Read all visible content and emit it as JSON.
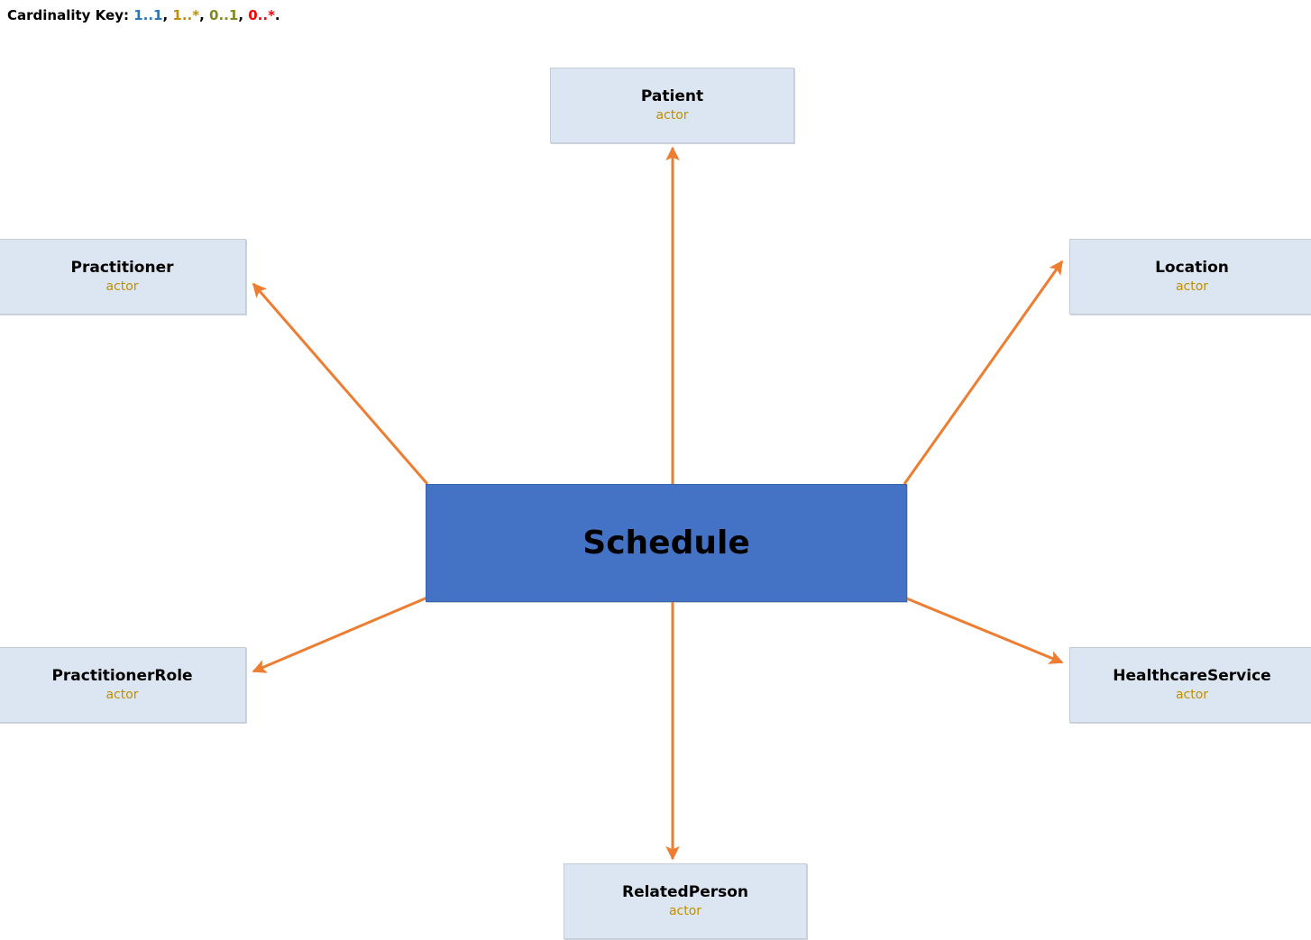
{
  "diagram": {
    "title": "Schedule",
    "background_color": "#ffffff",
    "connector_color": "#ed7d31",
    "central_fill": "#4472c4",
    "actor_fill": "#dce6f2",
    "actor_border": "#c3ccd9",
    "subtitle_color": "#bf8f00"
  },
  "cardinality_key": {
    "label": "Cardinality Key:",
    "entries": [
      {
        "text": "1..1",
        "color": "#2e75b6"
      },
      {
        "text": "1..*",
        "color": "#bf8f00"
      },
      {
        "text": "0..1",
        "color": "#7f8b1f"
      },
      {
        "text": "0..*",
        "color": "#ff0000"
      }
    ],
    "separator": ", ",
    "terminator": "."
  },
  "central": {
    "name": "Schedule"
  },
  "nodes": [
    {
      "id": "patient",
      "name": "Patient",
      "subtitle": "actor"
    },
    {
      "id": "practitioner",
      "name": "Practitioner",
      "subtitle": "actor"
    },
    {
      "id": "location",
      "name": "Location",
      "subtitle": "actor"
    },
    {
      "id": "practitionerrole",
      "name": "PractitionerRole",
      "subtitle": "actor"
    },
    {
      "id": "healthcareservice",
      "name": "HealthcareService",
      "subtitle": "actor"
    },
    {
      "id": "relatedperson",
      "name": "RelatedPerson",
      "subtitle": "actor"
    }
  ],
  "edges": [
    {
      "from": "Schedule",
      "to": "Patient",
      "direction": "to-target"
    },
    {
      "from": "Schedule",
      "to": "Practitioner",
      "direction": "to-target"
    },
    {
      "from": "Schedule",
      "to": "Location",
      "direction": "to-target"
    },
    {
      "from": "Schedule",
      "to": "PractitionerRole",
      "direction": "to-target"
    },
    {
      "from": "Schedule",
      "to": "HealthcareService",
      "direction": "to-target"
    },
    {
      "from": "Schedule",
      "to": "RelatedPerson",
      "direction": "to-target"
    }
  ]
}
